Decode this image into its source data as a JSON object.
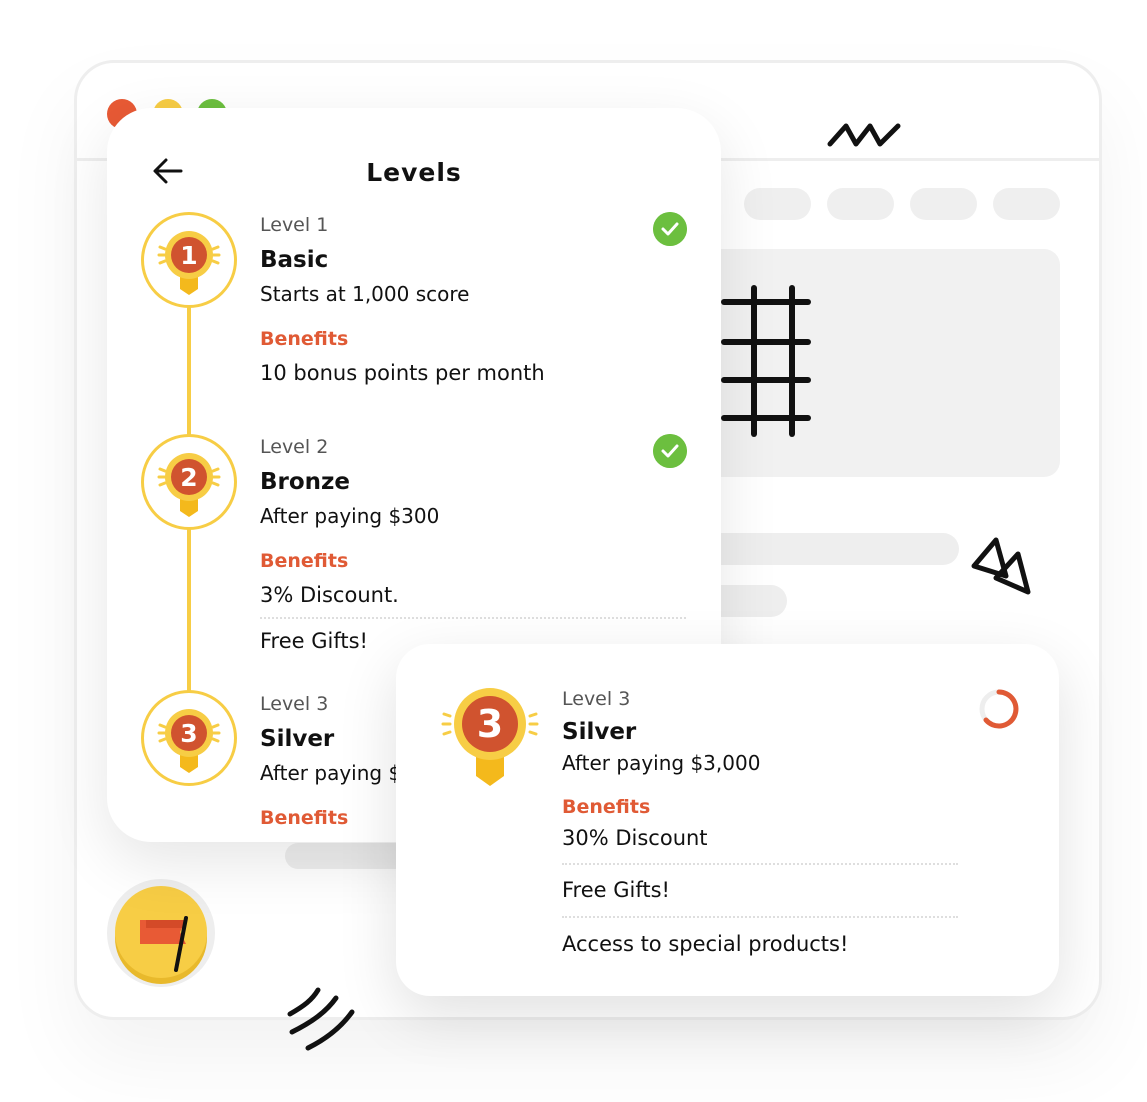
{
  "window": {
    "dots": [
      {
        "name": "close",
        "color": "#e85a35"
      },
      {
        "name": "minimize",
        "color": "#f7cd45"
      },
      {
        "name": "maximize",
        "color": "#6cbf3f"
      }
    ]
  },
  "levels_card": {
    "title": "Levels",
    "levels": [
      {
        "level_label": "Level 1",
        "medal_number": "1",
        "name": "Basic",
        "requirement": "Starts at 1,000 score",
        "benefits_label": "Benefits",
        "benefits": [
          "10 bonus points per month"
        ],
        "completed": true
      },
      {
        "level_label": "Level 2",
        "medal_number": "2",
        "name": "Bronze",
        "requirement": "After paying $300",
        "benefits_label": "Benefits",
        "benefits": [
          "3% Discount.",
          "Free Gifts!"
        ],
        "completed": true
      },
      {
        "level_label": "Level 3",
        "medal_number": "3",
        "name": "Silver",
        "requirement": "After paying $",
        "benefits_label": "Benefits",
        "benefits": [],
        "completed": false
      }
    ]
  },
  "detail_popup": {
    "level_label": "Level 3",
    "medal_number": "3",
    "name": "Silver",
    "requirement": "After paying $3,000",
    "benefits_label": "Benefits",
    "benefits": [
      "30% Discount",
      "Free Gifts!",
      "Access to special products!"
    ],
    "status_icon": "progress-ring-icon"
  },
  "colors": {
    "accent_orange": "#e05a35",
    "gold": "#f7cd45",
    "success_green": "#6cbf3f"
  }
}
